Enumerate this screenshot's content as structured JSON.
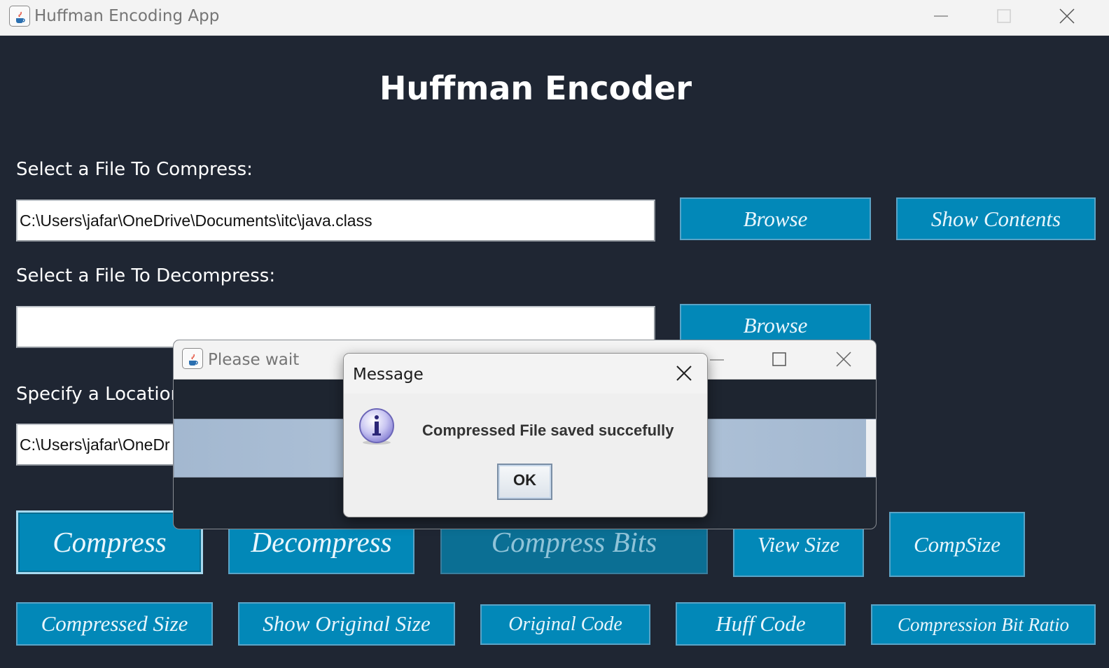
{
  "window": {
    "title": "Huffman Encoding App"
  },
  "main": {
    "heading": "Huffman Encoder",
    "compress_label": "Select a File To Compress:",
    "compress_path": "C:\\Users\\jafar\\OneDrive\\Documents\\itc\\java.class",
    "decompress_label": "Select a File To Decompress:",
    "decompress_path": "",
    "location_label": "Specify a Location",
    "location_path": "C:\\Users\\jafar\\OneDr",
    "browse_label": "Browse",
    "browse2_label": "Browse",
    "show_contents_label": "Show Contents"
  },
  "buttons_row1": [
    "Compress",
    "Decompress",
    "Compress Bits",
    "View Size",
    "CompSize"
  ],
  "buttons_row2": [
    "Compressed Size",
    "Show Original Size",
    "Original Code",
    "Huff Code",
    "Compression Bit Ratio"
  ],
  "wait_window": {
    "title": "Please wait",
    "progress": 0.985
  },
  "message_dialog": {
    "title": "Message",
    "text": "Compressed File saved succefully",
    "ok_label": "OK",
    "icon": "info-icon"
  },
  "colors": {
    "background": "#1f2633",
    "button": "#0288b8",
    "button_border": "#5aa3c6",
    "progress_fill": "#a3b8d0"
  }
}
